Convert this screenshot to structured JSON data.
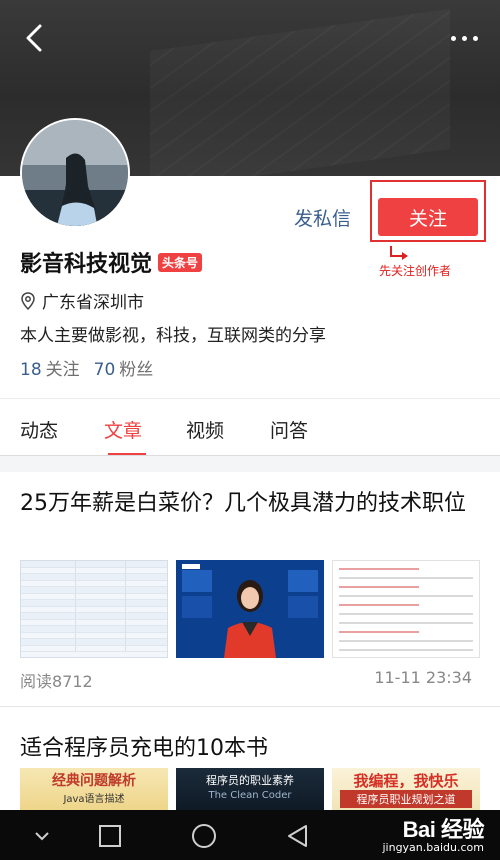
{
  "header": {
    "back_icon": "back-arrow-icon",
    "more_icon": "more-dots-icon"
  },
  "profile": {
    "name": "影音科技视觉",
    "badge": "头条号",
    "location": "广东省深圳市",
    "bio": "本人主要做影视，科技，互联网类的分享",
    "following_count": "18",
    "following_label": "关注",
    "followers_count": "70",
    "followers_label": "粉丝",
    "message_label": "发私信",
    "follow_label": "关注",
    "annotation": "先关注创作者"
  },
  "tabs": [
    {
      "label": "动态",
      "active": false
    },
    {
      "label": "文章",
      "active": true
    },
    {
      "label": "视频",
      "active": false
    },
    {
      "label": "问答",
      "active": false
    }
  ],
  "articles": [
    {
      "title": "25万年薪是白菜价？几个极具潜力的技术职位",
      "reads": "阅读8712",
      "time": "11-11 23:34"
    },
    {
      "title": "适合程序员充电的10本书",
      "books": [
        {
          "title": "经典问题解析",
          "subtitle": "Java语言描述"
        },
        {
          "title": "程序员的职业素养",
          "subtitle": "The Clean Coder"
        },
        {
          "title": "我编程，我快乐",
          "subtitle": "程序员职业规划之道"
        }
      ]
    }
  ],
  "watermark": {
    "main": "Bai 经验",
    "sub": "jingyan.baidu.com"
  },
  "colors": {
    "accent": "#f04142",
    "link": "#3a5f8f",
    "annotation": "#e02020"
  }
}
